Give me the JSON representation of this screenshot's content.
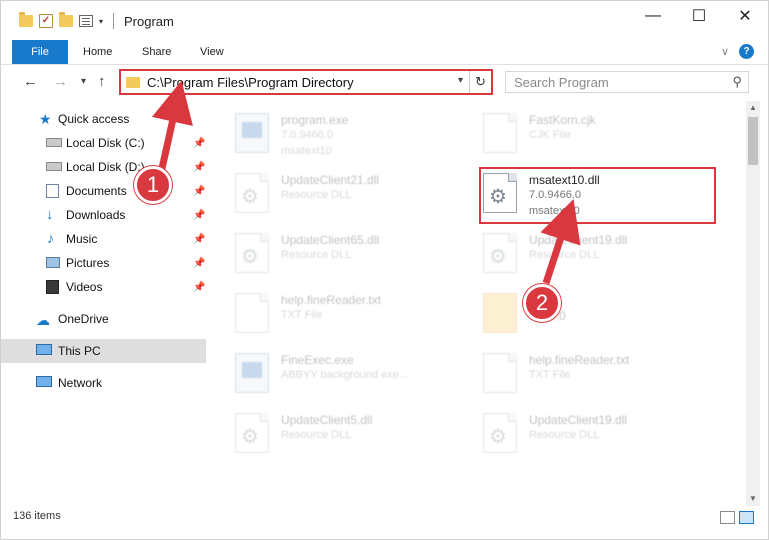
{
  "window": {
    "title": "Program",
    "controls": {
      "minimize": "—",
      "maximize": "☐",
      "close": "✕"
    }
  },
  "ribbon": {
    "tabs": [
      "File",
      "Home",
      "Share",
      "View"
    ],
    "help": "?"
  },
  "navigation": {
    "back": "←",
    "forward": "→",
    "recent": "▾",
    "up": "↑",
    "address_path": "C:\\Program Files\\Program Directory",
    "search_placeholder": "Search Program"
  },
  "sidebar": {
    "quick_access": "Quick access",
    "items": [
      {
        "label": "Local Disk (C:)",
        "icon": "drive-icon",
        "pinned": true
      },
      {
        "label": "Local Disk (D:)",
        "icon": "drive-icon",
        "pinned": true
      },
      {
        "label": "Documents",
        "icon": "documents-icon",
        "pinned": true
      },
      {
        "label": "Downloads",
        "icon": "downloads-icon",
        "pinned": true
      },
      {
        "label": "Music",
        "icon": "music-icon",
        "pinned": true
      },
      {
        "label": "Pictures",
        "icon": "pictures-icon",
        "pinned": true
      },
      {
        "label": "Videos",
        "icon": "videos-icon",
        "pinned": true
      }
    ],
    "onedrive": "OneDrive",
    "this_pc": "This PC",
    "network": "Network"
  },
  "files": [
    {
      "name": "program.exe",
      "line2": "7.0.9466.0",
      "line3": "msatext10",
      "type": "exe",
      "faded": true
    },
    {
      "name": "FastKorn.cjk",
      "line2": "CJK File",
      "line3": "",
      "type": "doc",
      "faded": true
    },
    {
      "name": "UpdateClient21.dll",
      "line2": "Resource DLL",
      "line3": "",
      "type": "dll",
      "faded": true
    },
    {
      "name": "msatext10.dll",
      "line2": "7.0.9466.0",
      "line3": "msatext10",
      "type": "dll",
      "faded": false
    },
    {
      "name": "UpdateClient65.dll",
      "line2": "Resource DLL",
      "line3": "",
      "type": "dll",
      "faded": true
    },
    {
      "name": "UpdateClient19.dll",
      "line2": "Resource DLL",
      "line3": "",
      "type": "dll",
      "faded": true
    },
    {
      "name": "help.fineReader.txt",
      "line2": "TXT File",
      "line3": "",
      "type": "doc",
      "faded": true
    },
    {
      "name": "9466.0",
      "line2": "",
      "line3": "",
      "type": "folder",
      "faded": true
    },
    {
      "name": "FineExec.exe",
      "line2": "ABBYY background exe...",
      "line3": "",
      "type": "exe",
      "faded": true
    },
    {
      "name": "help.fineReader.txt",
      "line2": "TXT File",
      "line3": "",
      "type": "doc",
      "faded": true
    },
    {
      "name": "UpdateClient5.dll",
      "line2": "Resource DLL",
      "line3": "",
      "type": "dll",
      "faded": true
    },
    {
      "name": "UpdateClient19.dll",
      "line2": "Resource DLL",
      "line3": "",
      "type": "dll",
      "faded": true
    }
  ],
  "annotations": {
    "step1": "1",
    "step2": "2"
  },
  "status": {
    "item_count": "136 items"
  },
  "colors": {
    "accent": "#1979ca",
    "highlight": "#d9383f",
    "selected_bg": "#dedede"
  }
}
